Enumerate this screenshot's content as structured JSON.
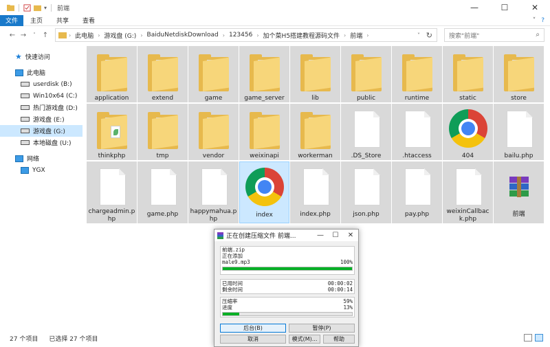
{
  "window": {
    "title": "前端",
    "controls": [
      "—",
      "☐",
      "✕"
    ]
  },
  "ribbon": {
    "tabs": [
      "文件",
      "主页",
      "共享",
      "查看"
    ]
  },
  "nav": {
    "crumbs": [
      "此电脑",
      "游戏盘 (G:)",
      "BaiduNetdiskDownload",
      "123456",
      "加个菜H5搭建教程源码文件",
      "前端"
    ],
    "search_placeholder": "搜索\"前端\""
  },
  "sidebar": {
    "items": [
      {
        "label": "快速访问",
        "type": "star"
      },
      {
        "label": "此电脑",
        "type": "pc"
      },
      {
        "label": "userdisk (B:)",
        "type": "drive"
      },
      {
        "label": "Win10x64 (C:)",
        "type": "drive"
      },
      {
        "label": "热门游戏盘 (D:)",
        "type": "drive"
      },
      {
        "label": "游戏盘 (E:)",
        "type": "drive"
      },
      {
        "label": "游戏盘 (G:)",
        "type": "drive",
        "selected": true
      },
      {
        "label": "本地磁盘 (U:)",
        "type": "drive"
      },
      {
        "label": "网络",
        "type": "net"
      },
      {
        "label": "YGX",
        "type": "pc"
      }
    ]
  },
  "files": [
    {
      "name": "application",
      "kind": "folder"
    },
    {
      "name": "extend",
      "kind": "folder"
    },
    {
      "name": "game",
      "kind": "folder"
    },
    {
      "name": "game_server",
      "kind": "folder"
    },
    {
      "name": "lib",
      "kind": "folder"
    },
    {
      "name": "public",
      "kind": "folder"
    },
    {
      "name": "runtime",
      "kind": "folder"
    },
    {
      "name": "static",
      "kind": "folder"
    },
    {
      "name": "store",
      "kind": "folder"
    },
    {
      "name": "thinkphp",
      "kind": "folder-badge"
    },
    {
      "name": "tmp",
      "kind": "folder"
    },
    {
      "name": "vendor",
      "kind": "folder"
    },
    {
      "name": "weixinapi",
      "kind": "folder"
    },
    {
      "name": "workerman",
      "kind": "folder"
    },
    {
      "name": ".DS_Store",
      "kind": "doc"
    },
    {
      "name": ".htaccess",
      "kind": "doc"
    },
    {
      "name": "404",
      "kind": "chrome"
    },
    {
      "name": "bailu.php",
      "kind": "doc"
    },
    {
      "name": "chargeadmin.php",
      "kind": "doc"
    },
    {
      "name": "game.php",
      "kind": "doc"
    },
    {
      "name": "happymahua.php",
      "kind": "doc"
    },
    {
      "name": "index",
      "kind": "chrome",
      "selected": true
    },
    {
      "name": "index.php",
      "kind": "doc"
    },
    {
      "name": "json.php",
      "kind": "doc"
    },
    {
      "name": "pay.php",
      "kind": "doc"
    },
    {
      "name": "weixinCallback.php",
      "kind": "doc"
    },
    {
      "name": "前端",
      "kind": "rar"
    }
  ],
  "status": {
    "count": "27 个项目",
    "selected": "已选择 27 个项目"
  },
  "dialog": {
    "title": "正在创建压缩文件 前端...",
    "archive": "前端.zip",
    "adding": "正在添加",
    "current_file": "male9.mp3",
    "file_percent_text": "100%",
    "file_progress": 1.0,
    "elapsed_label": "已用时间",
    "elapsed": "00:00:02",
    "remaining_label": "剩余时间",
    "remaining": "00:00:14",
    "ratio_label": "压缩率",
    "ratio": "59%",
    "progress_label": "进度",
    "progress_text": "13%",
    "total_progress": 0.13,
    "buttons": {
      "background": "后台(B)",
      "pause": "暂停(P)",
      "cancel": "取消",
      "mode": "模式(M)...",
      "help": "帮助"
    }
  }
}
